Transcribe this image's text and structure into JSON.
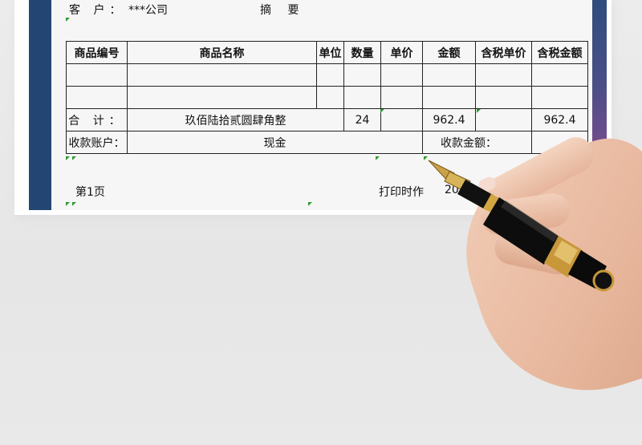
{
  "header": {
    "customer_label": "客 户：",
    "customer_value": "***公司",
    "summary_label": "摘 要"
  },
  "table": {
    "headers": [
      "商品编号",
      "商品名称",
      "单位",
      "数量",
      "单价",
      "金额",
      "含税单价",
      "含税金额"
    ],
    "total_row": {
      "label": "合 计：",
      "amount_in_words": "玖佰陆拾贰圆肆角整",
      "quantity": "24",
      "amount": "962.4",
      "tax_amount": "962.4"
    },
    "account_row": {
      "account_label": "收款账户：",
      "account_value": "现金",
      "received_label": "收款金额："
    }
  },
  "footer": {
    "page": "第1页",
    "print_time_label": "打印时作",
    "print_time_value": "20"
  },
  "colors": {
    "left_band": "#234574",
    "sheet": "#ffffff",
    "gridline": "#222222",
    "cell_marker": "#2e9a2e"
  },
  "icons": {
    "pen": "fountain-pen-icon",
    "hand": "hand-icon"
  }
}
